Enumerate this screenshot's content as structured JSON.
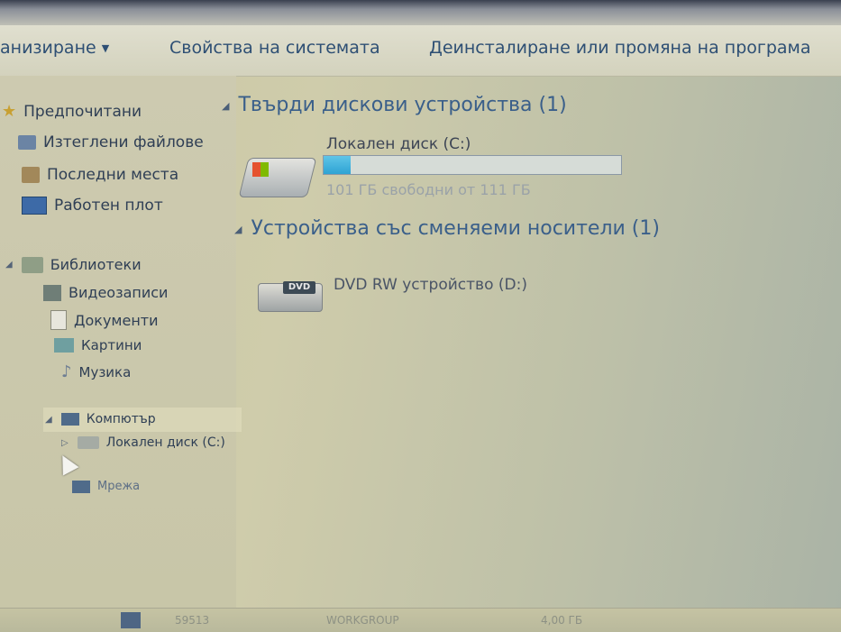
{
  "toolbar": {
    "organize": "анизиране",
    "system_properties": "Свойства на системата",
    "uninstall": "Деинсталиране или промяна на програма"
  },
  "nav": {
    "favorites": "Предпочитани",
    "downloads": "Изтеглени файлове",
    "recent": "Последни места",
    "desktop": "Работен плот",
    "libraries": "Библиотеки",
    "videos": "Видеозаписи",
    "documents": "Документи",
    "pictures": "Картини",
    "music": "Музика",
    "computer": "Компютър",
    "local_disk": "Локален диск (C:)",
    "network": "Мрежа"
  },
  "content": {
    "hdd_group": "Твърди дискови устройства (1)",
    "drive_c_name": "Локален диск (C:)",
    "drive_c_free": "101 ГБ свободни от 111 ГБ",
    "drive_c_used_fraction": 0.09,
    "removable_group": "Устройства със сменяеми носители (1)",
    "dvd_name": "DVD RW устройство (D:)",
    "dvd_badge": "DVD"
  },
  "status": {
    "left": "59513",
    "middle": "WORKGROUP",
    "right": "4,00 ГБ"
  },
  "icons": {
    "colors": {
      "bar_fill": "#2ea3d4",
      "link_text": "#2e4f74"
    }
  }
}
